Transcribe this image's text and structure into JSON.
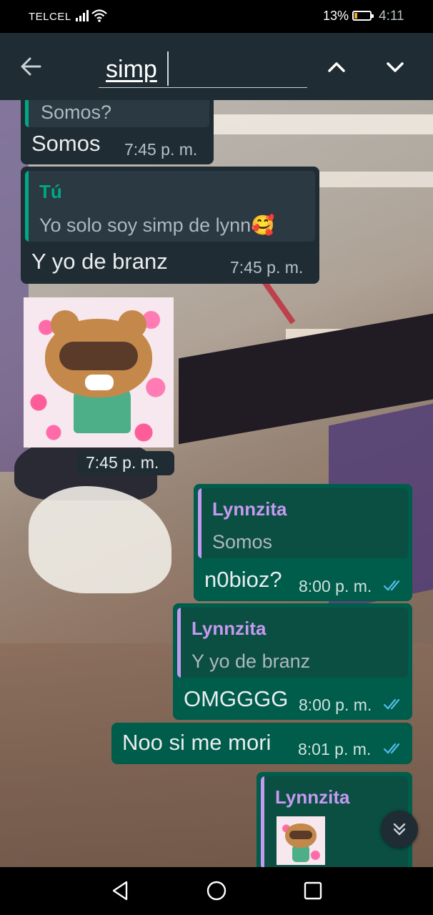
{
  "status_bar": {
    "carrier": "TELCEL",
    "battery_percent": "13%",
    "time": "4:11"
  },
  "search": {
    "query": "simp"
  },
  "messages": [
    {
      "direction": "incoming",
      "quote_text_partial": "Somos?",
      "text": "Somos",
      "time": "7:45 p. m."
    },
    {
      "direction": "incoming",
      "quote_author": "Tú",
      "quote_text": "Yo solo soy simp de lynn🥰",
      "text": "Y yo de branz",
      "time": "7:45 p. m."
    },
    {
      "direction": "incoming",
      "type": "sticker",
      "time": "7:45 p. m."
    },
    {
      "direction": "outgoing",
      "quote_author": "Lynnzita",
      "quote_text": "Somos",
      "text": "n0bioz?",
      "time": "8:00 p. m.",
      "status": "read"
    },
    {
      "direction": "outgoing",
      "quote_author": "Lynnzita",
      "quote_text": "Y yo de branz",
      "text": "OMGGGG",
      "time": "8:00 p. m.",
      "status": "read"
    },
    {
      "direction": "outgoing",
      "text": "Noo si me mori",
      "time": "8:01 p. m.",
      "status": "read"
    },
    {
      "direction": "outgoing",
      "quote_author": "Lynnzita",
      "quote_type": "sticker"
    }
  ],
  "colors": {
    "header_bg": "#1f2c34",
    "incoming_bubble": "#202c33",
    "outgoing_bubble": "#005c4b",
    "quote_name_tu": "#00a884",
    "quote_name_lynnzita": "#c59af0",
    "read_tick": "#53bdeb"
  },
  "icons": {
    "back": "arrow-left-icon",
    "search_up": "chevron-up-icon",
    "search_down": "chevron-down-icon",
    "scroll_down": "double-chevron-down-icon",
    "read_receipt": "double-check-icon"
  }
}
